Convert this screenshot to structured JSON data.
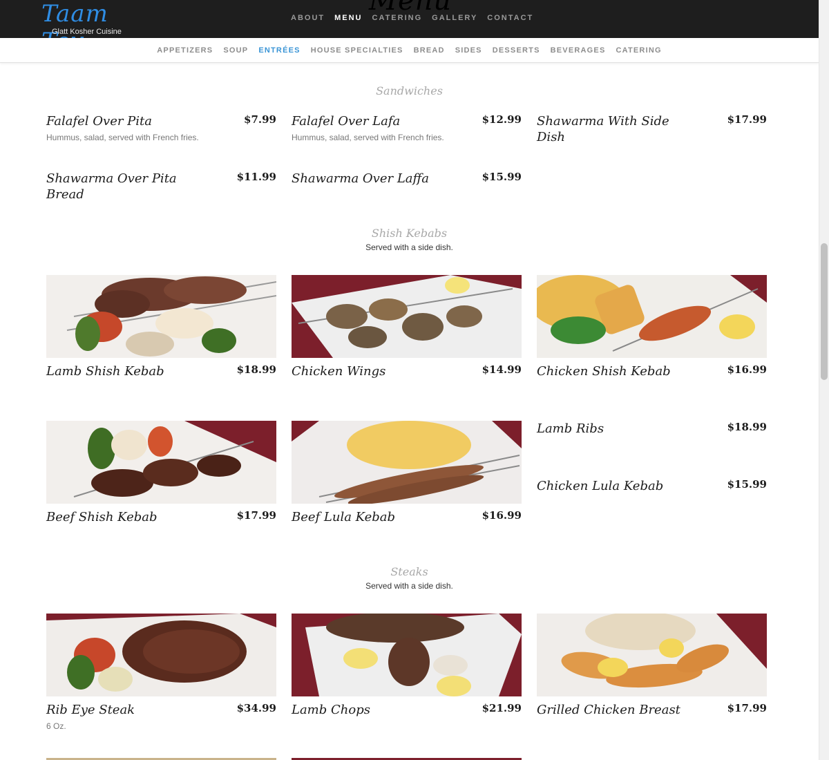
{
  "header": {
    "ghost_title": "Menu",
    "logo_script": "Taam Tov",
    "logo_sub": "Glatt Kosher Cuisine",
    "nav": [
      "ABOUT",
      "MENU",
      "CATERING",
      "GALLERY",
      "CONTACT"
    ],
    "active_nav": "MENU"
  },
  "subnav": {
    "items": [
      "APPETIZERS",
      "SOUP",
      "ENTRÉES",
      "HOUSE SPECIALTIES",
      "BREAD",
      "SIDES",
      "DESSERTS",
      "BEVERAGES",
      "CATERING"
    ],
    "active": "ENTRÉES",
    "accent_color": "#3b95d6"
  },
  "sections": {
    "sandwiches": {
      "title": "Sandwiches",
      "items": [
        {
          "name": "Falafel Over Pita",
          "price": "$7.99",
          "desc": "Hummus, salad, served with French fries."
        },
        {
          "name": "Falafel Over Lafa",
          "price": "$12.99",
          "desc": "Hummus, salad, served with French fries."
        },
        {
          "name": "Shawarma With Side Dish",
          "price": "$17.99"
        },
        {
          "name": "Shawarma Over Pita Bread",
          "price": "$11.99"
        },
        {
          "name": "Shawarma Over Laffa",
          "price": "$15.99"
        }
      ]
    },
    "kebabs": {
      "title": "Shish Kebabs",
      "note": "Served with a side dish.",
      "items": [
        {
          "name": "Lamb Shish Kebab",
          "price": "$18.99",
          "photo": "lamb-kebab-photo"
        },
        {
          "name": "Chicken Wings",
          "price": "$14.99",
          "photo": "chicken-wings-photo"
        },
        {
          "name": "Chicken Shish Kebab",
          "price": "$16.99",
          "photo": "chicken-kebab-photo"
        },
        {
          "name": "Beef Shish Kebab",
          "price": "$17.99",
          "photo": "beef-kebab-photo"
        },
        {
          "name": "Beef Lula Kebab",
          "price": "$16.99",
          "photo": "beef-lula-photo"
        },
        {
          "name": "Lamb Ribs",
          "price": "$18.99"
        },
        {
          "name": "Chicken Lula Kebab",
          "price": "$15.99"
        }
      ]
    },
    "steaks": {
      "title": "Steaks",
      "note": "Served with a side dish.",
      "items": [
        {
          "name": "Rib Eye Steak",
          "price": "$34.99",
          "desc": "6 Oz.",
          "photo": "rib-eye-photo"
        },
        {
          "name": "Lamb Chops",
          "price": "$21.99",
          "photo": "lamb-chops-photo"
        },
        {
          "name": "Grilled Chicken Breast",
          "price": "$17.99",
          "photo": "chicken-breast-photo"
        }
      ]
    }
  }
}
